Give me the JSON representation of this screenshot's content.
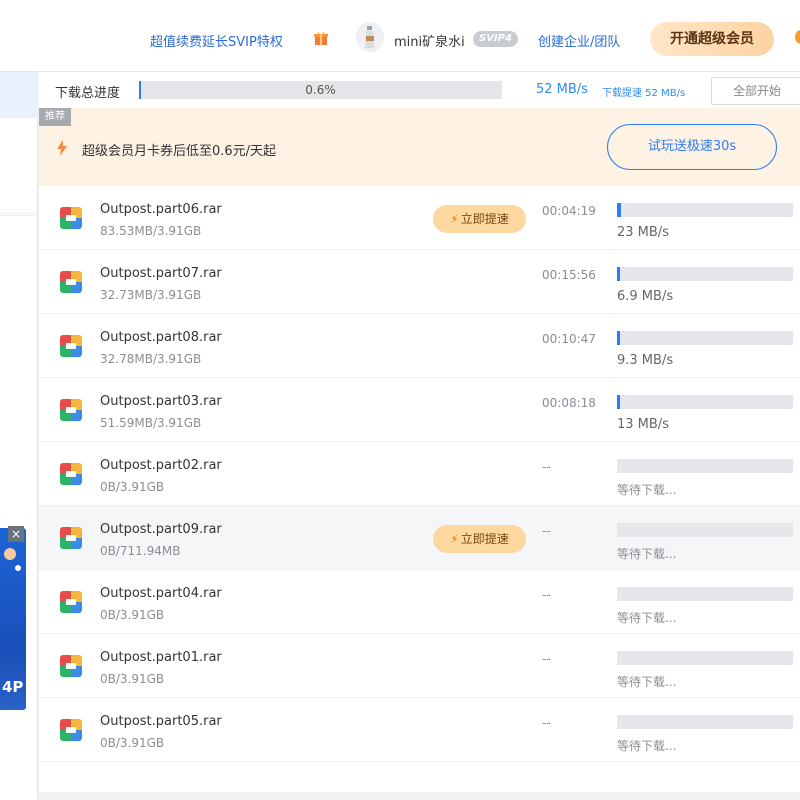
{
  "header": {
    "renew_link": "超值续费延长SVIP特权",
    "gift_icon": "gift-icon",
    "username": "mini矿泉水i",
    "svip_badge": "SVIP4",
    "enterprise_link": "创建企业/团队",
    "vip_button": "开通超级会员",
    "accent": "#2b6bd6"
  },
  "progress": {
    "label": "下载总进度",
    "percent_text": "0.6%",
    "percent": 0.6,
    "speed": "52 MB/s",
    "boost_label": "下载提速 52 MB/s",
    "start_all": "全部开始"
  },
  "promo": {
    "tag": "推荐",
    "text": "超级会员月卡券后低至0.6元/天起",
    "button": "试玩送极速30s"
  },
  "sidebar": {
    "ad_text": "4P",
    "close": "×"
  },
  "boost_label": "立即提速",
  "files": [
    {
      "name": "Outpost.part06.rar",
      "size": "83.53MB/3.91GB",
      "time": "00:04:19",
      "status": "23 MB/s",
      "progress": 2.1,
      "downloading": true,
      "boost": true
    },
    {
      "name": "Outpost.part07.rar",
      "size": "32.73MB/3.91GB",
      "time": "00:15:56",
      "status": "6.9 MB/s",
      "progress": 0.8,
      "downloading": true,
      "boost": false
    },
    {
      "name": "Outpost.part08.rar",
      "size": "32.78MB/3.91GB",
      "time": "00:10:47",
      "status": "9.3 MB/s",
      "progress": 0.8,
      "downloading": true,
      "boost": false
    },
    {
      "name": "Outpost.part03.rar",
      "size": "51.59MB/3.91GB",
      "time": "00:08:18",
      "status": "13 MB/s",
      "progress": 1.3,
      "downloading": true,
      "boost": false
    },
    {
      "name": "Outpost.part02.rar",
      "size": "0B/3.91GB",
      "time": "--",
      "status": "等待下载...",
      "progress": 0,
      "downloading": false,
      "boost": false
    },
    {
      "name": "Outpost.part09.rar",
      "size": "0B/711.94MB",
      "time": "--",
      "status": "等待下载...",
      "progress": 0,
      "downloading": false,
      "boost": true
    },
    {
      "name": "Outpost.part04.rar",
      "size": "0B/3.91GB",
      "time": "--",
      "status": "等待下载...",
      "progress": 0,
      "downloading": false,
      "boost": false
    },
    {
      "name": "Outpost.part01.rar",
      "size": "0B/3.91GB",
      "time": "--",
      "status": "等待下载...",
      "progress": 0,
      "downloading": false,
      "boost": false
    },
    {
      "name": "Outpost.part05.rar",
      "size": "0B/3.91GB",
      "time": "--",
      "status": "等待下载...",
      "progress": 0,
      "downloading": false,
      "boost": false
    }
  ]
}
